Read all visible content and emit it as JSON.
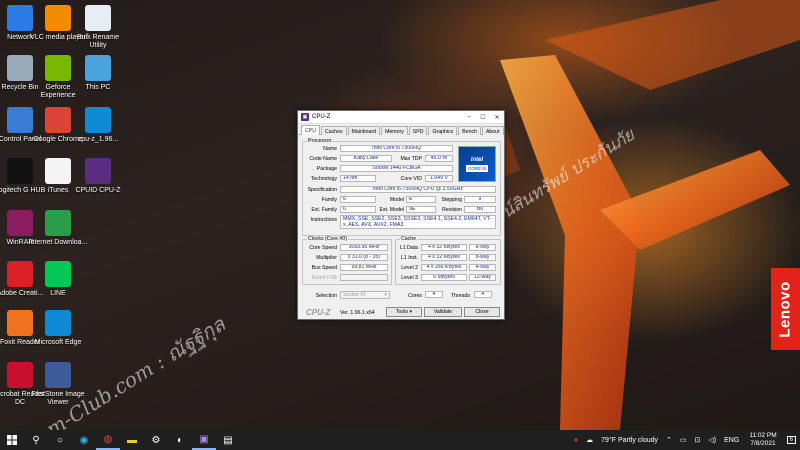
{
  "desktop": {
    "icons": [
      {
        "label": "Network",
        "icon": "network-icon",
        "color": "#2c7be5"
      },
      {
        "label": "VLC media player",
        "icon": "vlc-icon",
        "color": "#f28b00"
      },
      {
        "label": "Bulk Rename Utility",
        "icon": "bulk-rename-icon",
        "color": "#e8eef8"
      },
      {
        "label": "Recycle Bin",
        "icon": "recycle-bin-icon",
        "color": "#9ab"
      },
      {
        "label": "Geforce Experience",
        "icon": "geforce-icon",
        "color": "#76b900"
      },
      {
        "label": "This PC",
        "icon": "this-pc-icon",
        "color": "#4aa3df"
      },
      {
        "label": "Control Panel",
        "icon": "control-panel-icon",
        "color": "#3a7bd5"
      },
      {
        "label": "Google Chrome",
        "icon": "chrome-icon",
        "color": "#db4437"
      },
      {
        "label": "cpu-z_1.96...",
        "icon": "edge-icon",
        "color": "#0f8bd6"
      },
      {
        "label": "Logitech G HUB",
        "icon": "logitech-icon",
        "color": "#111"
      },
      {
        "label": "iTunes",
        "icon": "itunes-icon",
        "color": "#f4f4f4"
      },
      {
        "label": "CPUID CPU-Z",
        "icon": "cpuz-icon",
        "color": "#5a2d82"
      },
      {
        "label": "WinRAR",
        "icon": "winrar-icon",
        "color": "#8b1c62"
      },
      {
        "label": "Internet Downloa...",
        "icon": "idm-icon",
        "color": "#2a9d4b"
      },
      {
        "label": "Adobe Creati...",
        "icon": "adobe-cc-icon",
        "color": "#da1f26"
      },
      {
        "label": "LINE",
        "icon": "line-icon",
        "color": "#06c755"
      },
      {
        "label": "Foxit Reader",
        "icon": "foxit-icon",
        "color": "#f0731f"
      },
      {
        "label": "Microsoft Edge",
        "icon": "edge-icon",
        "color": "#0f8bd6"
      },
      {
        "label": "Acrobat Reader DC",
        "icon": "acrobat-icon",
        "color": "#c8102e"
      },
      {
        "label": "FastStone Image Viewer",
        "icon": "faststone-icon",
        "color": "#3d5a99"
      }
    ]
  },
  "wallpaper": {
    "watermark_1": "com-Club.com : ณัฐฐิกุล",
    "watermark_2": "ณัฐฐิกุลวิวัฒน์สินทรัพย์ ประกันภัย",
    "lenovo": "Lenovo"
  },
  "cpuz": {
    "title": "CPU-Z",
    "tabs": [
      "CPU",
      "Caches",
      "Mainboard",
      "Memory",
      "SPD",
      "Graphics",
      "Bench",
      "About"
    ],
    "processor": {
      "group_label": "Processor",
      "name_label": "Name",
      "name": "Intel Core i5 7300HQ",
      "codename_label": "Code Name",
      "codename": "Kaby Lake",
      "maxtdp_label": "Max TDP",
      "maxtdp": "45.0 W",
      "package_label": "Package",
      "package": "Socket 1440 FCBGA",
      "technology_label": "Technology",
      "technology": "14 nm",
      "corevid_label": "Core VID",
      "corevid": "1.049 V",
      "spec_label": "Specification",
      "spec": "Intel Core i5-7300HQ CPU @ 2.50GHz",
      "family_label": "Family",
      "family": "6",
      "model_label": "Model",
      "model": "E",
      "stepping_label": "Stepping",
      "stepping": "9",
      "extfamily_label": "Ext. Family",
      "extfamily": "6",
      "extmodel_label": "Ext. Model",
      "extmodel": "9E",
      "revision_label": "Revision",
      "revision": "B0",
      "instructions_label": "Instructions",
      "instructions": "MMX, SSE, SSE2, SSE3, SSSE3, SSE4.1, SSE4.2, EM64T, VT-x, AES, AVX, AVX2, FMA3",
      "logo_brand": "intel",
      "logo_core": "CORE i5"
    },
    "clocks": {
      "group_label": "Clocks (Core #0)",
      "corespeed_label": "Core Speed",
      "corespeed": "3093.96 MHz",
      "multiplier_label": "Multiplier",
      "multiplier": "x 31.0 (8 - 35)",
      "busspeed_label": "Bus Speed",
      "busspeed": "99.81 MHz",
      "ratedfsb_label": "Rated FSB",
      "ratedfsb": ""
    },
    "cache": {
      "group_label": "Cache",
      "rows": [
        {
          "label": "L1 Data",
          "size": "4 x 32 KBytes",
          "way": "8-way"
        },
        {
          "label": "L1 Inst.",
          "size": "4 x 32 KBytes",
          "way": "8-way"
        },
        {
          "label": "Level 2",
          "size": "4 x 256 KBytes",
          "way": "4-way"
        },
        {
          "label": "Level 3",
          "size": "6 MBytes",
          "way": "12-way"
        }
      ]
    },
    "selection_label": "Selection",
    "selection_value": "Socket #1",
    "cores_label": "Cores",
    "cores": "4",
    "threads_label": "Threads",
    "threads": "4",
    "brand": "CPU-Z",
    "version": "Ver. 1.96.1.x64",
    "tools_label": "Tools",
    "validate_label": "Validate",
    "close_label": "Close"
  },
  "taskbar": {
    "weather": "79°F  Partly cloudy",
    "language": "ENG",
    "time": "11:02 PM",
    "date": "7/8/2021",
    "notification_count": "6"
  }
}
